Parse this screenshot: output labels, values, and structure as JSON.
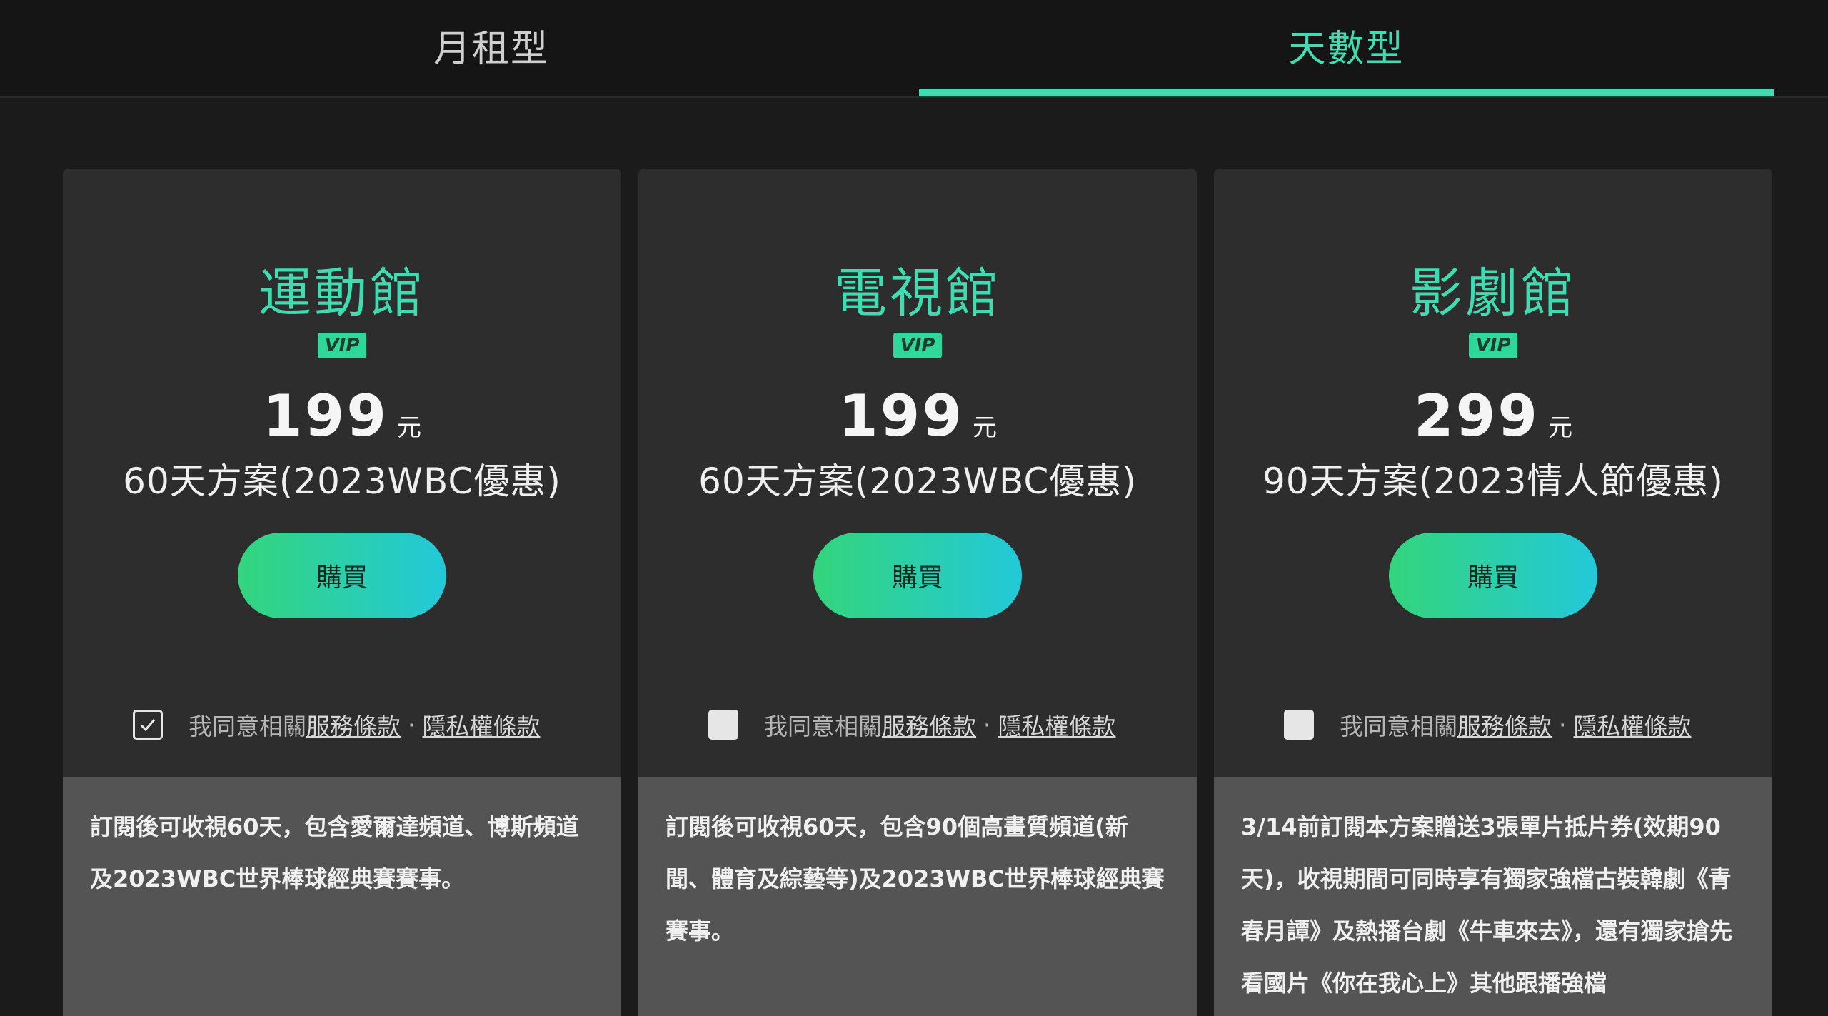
{
  "tabs": [
    {
      "label": "月租型",
      "active": false
    },
    {
      "label": "天數型",
      "active": true
    }
  ],
  "colors": {
    "accent": "#3fdcb2",
    "button_gradient_start": "#34d57c",
    "button_gradient_end": "#22c9d9",
    "card_bg": "#2d2d2d",
    "desc_bg": "#545454"
  },
  "cards": [
    {
      "title": "運動館",
      "badge": "VIP",
      "price": "199",
      "unit": "元",
      "plan": "60天方案(2023WBC優惠)",
      "buy_label": "購買",
      "agree_checked": true,
      "agree_text": "我同意相關",
      "terms_link": "服務條款",
      "separator": "·",
      "privacy_link": "隱私權條款",
      "description": "訂閱後可收視60天，包含愛爾達頻道、博斯頻道及2023WBC世界棒球經典賽賽事。"
    },
    {
      "title": "電視館",
      "badge": "VIP",
      "price": "199",
      "unit": "元",
      "plan": "60天方案(2023WBC優惠)",
      "buy_label": "購買",
      "agree_checked": false,
      "agree_text": "我同意相關",
      "terms_link": "服務條款",
      "separator": "·",
      "privacy_link": "隱私權條款",
      "description": "訂閱後可收視60天，包含90個高畫質頻道(新聞、體育及綜藝等)及2023WBC世界棒球經典賽賽事。"
    },
    {
      "title": "影劇館",
      "badge": "VIP",
      "price": "299",
      "unit": "元",
      "plan": "90天方案(2023情人節優惠)",
      "buy_label": "購買",
      "agree_checked": false,
      "agree_text": "我同意相關",
      "terms_link": "服務條款",
      "separator": "·",
      "privacy_link": "隱私權條款",
      "description": "3/14前訂閱本方案贈送3張單片抵片券(效期90天)，收視期間可同時享有獨家強檔古裝韓劇《青春月譚》及熱播台劇《牛車來去》，還有獨家搶先看國片《你在我心上》其他跟播強檔"
    }
  ]
}
